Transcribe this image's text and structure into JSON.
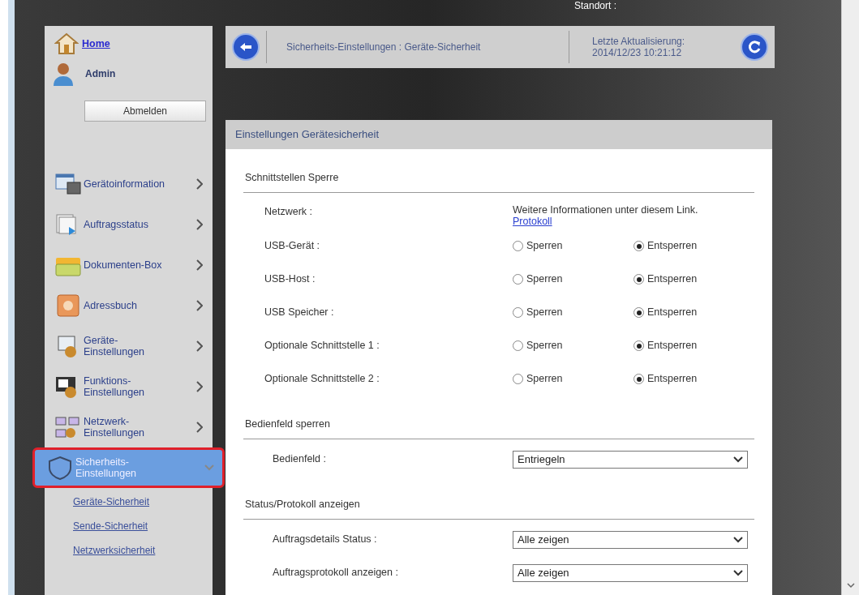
{
  "header": {
    "location_label": "Standort :"
  },
  "user": {
    "home": "Home",
    "name": "Admin",
    "logout": "Abmelden"
  },
  "sidebar": {
    "items": [
      {
        "label": "Gerätoinformation",
        "kind": "info",
        "selected": false
      },
      {
        "label": "Auftragsstatus",
        "kind": "jobs",
        "selected": false
      },
      {
        "label": "Dokumenten-Box",
        "kind": "box",
        "selected": false
      },
      {
        "label": "Adressbuch",
        "kind": "address",
        "selected": false
      },
      {
        "label": "Geräte-\nEinstellungen",
        "kind": "device",
        "selected": false
      },
      {
        "label": "Funktions-\nEinstellungen",
        "kind": "function",
        "selected": false
      },
      {
        "label": "Netzwerk-\nEinstellungen",
        "kind": "network",
        "selected": false
      },
      {
        "label": "Sicherheits-\nEinstellungen",
        "kind": "security",
        "selected": true
      }
    ],
    "subitems": [
      "Geräte-Sicherheit",
      "Sende-Sicherheit",
      "Netzwerksicherheit"
    ]
  },
  "breadcrumb": "Sicherheits-Einstellungen : Geräte-Sicherheit",
  "last_update": {
    "label": "Letzte Aktualisierung:",
    "value": "2014/12/23 10:21:12"
  },
  "panel": {
    "title": "Einstellungen Gerätesicherheit",
    "sections": [
      {
        "title": "Schnittstellen Sperre",
        "rows": [
          {
            "kind": "info",
            "label": "Netzwerk :",
            "text": "Weitere Informationen unter diesem Link.",
            "link": "Protokoll"
          },
          {
            "kind": "radio",
            "label": "USB-Gerät :",
            "options": [
              {
                "label": "Sperren",
                "selected": false
              },
              {
                "label": "Entsperren",
                "selected": true
              }
            ]
          },
          {
            "kind": "radio",
            "label": "USB-Host :",
            "options": [
              {
                "label": "Sperren",
                "selected": false
              },
              {
                "label": "Entsperren",
                "selected": true
              }
            ]
          },
          {
            "kind": "radio",
            "label": "USB Speicher :",
            "options": [
              {
                "label": "Sperren",
                "selected": false
              },
              {
                "label": "Entsperren",
                "selected": true
              }
            ]
          },
          {
            "kind": "radio",
            "label": "Optionale Schnittstelle 1 :",
            "options": [
              {
                "label": "Sperren",
                "selected": false
              },
              {
                "label": "Entsperren",
                "selected": true
              }
            ]
          },
          {
            "kind": "radio",
            "label": "Optionale Schnittstelle 2 :",
            "options": [
              {
                "label": "Sperren",
                "selected": false
              },
              {
                "label": "Entsperren",
                "selected": true
              }
            ]
          }
        ]
      },
      {
        "title": "Bedienfeld sperren",
        "rows": [
          {
            "kind": "select",
            "label": "Bedienfeld :",
            "value": "Entriegeln"
          }
        ]
      },
      {
        "title": "Status/Protokoll anzeigen",
        "rows": [
          {
            "kind": "select",
            "label": "Auftragsdetails Status :",
            "value": "Alle zeigen"
          },
          {
            "kind": "select",
            "label": "Auftragsprotokoll anzeigen :",
            "value": "Alle zeigen"
          }
        ]
      }
    ]
  }
}
